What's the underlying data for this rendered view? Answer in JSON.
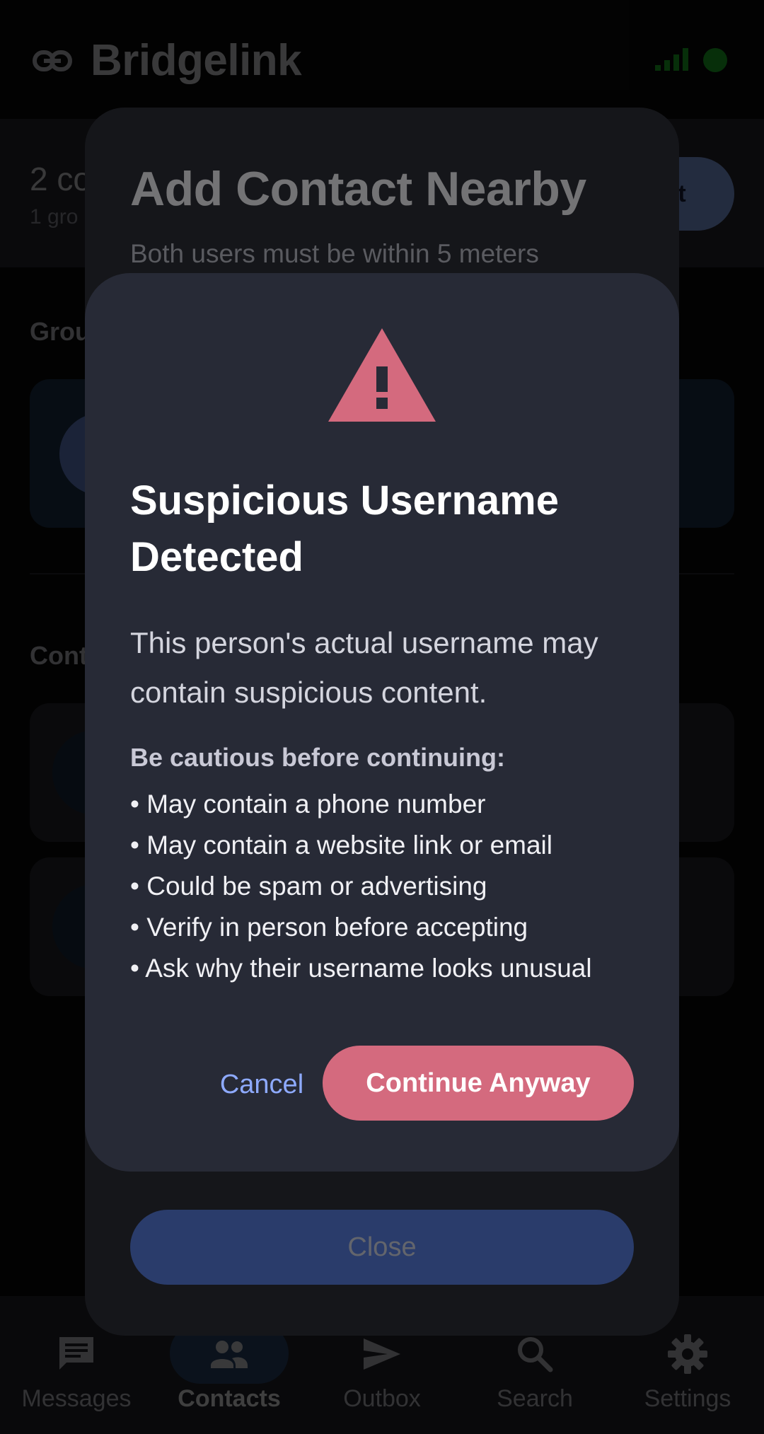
{
  "app_bar": {
    "title": "Bridgelink",
    "icons": [
      "link-icon",
      "signal-icon",
      "online-status-dot"
    ],
    "status_color": "#1fbf2a"
  },
  "summary": {
    "count_text": "2 co",
    "sub_text": "1 gro",
    "add_button_label": "t"
  },
  "sections": {
    "groups_title": "Grou",
    "contacts_title": "Cont"
  },
  "bottom_nav": {
    "items": [
      {
        "label": "Messages",
        "icon": "message-icon",
        "active": false
      },
      {
        "label": "Contacts",
        "icon": "people-icon",
        "active": true
      },
      {
        "label": "Outbox",
        "icon": "send-icon",
        "active": false
      },
      {
        "label": "Search",
        "icon": "search-icon",
        "active": false
      },
      {
        "label": "Settings",
        "icon": "gear-icon",
        "active": false
      }
    ]
  },
  "sheet": {
    "title": "Add Contact Nearby",
    "subtitle": "Both users must be within 5 meters",
    "close_label": "Close"
  },
  "dialog": {
    "icon": "warning-triangle-icon",
    "title": "Suspicious Username Detected",
    "body": "This person's actual username may contain suspicious content.",
    "caution_heading": "Be cautious before continuing:",
    "bullets": [
      "May contain a phone number",
      "May contain a website link or email",
      "Could be spam or advertising",
      "Verify in person before accepting",
      "Ask why their username looks unusual"
    ],
    "cancel_label": "Cancel",
    "continue_label": "Continue Anyway",
    "accent_color": "#d46a7e",
    "link_color": "#8eaaff"
  }
}
